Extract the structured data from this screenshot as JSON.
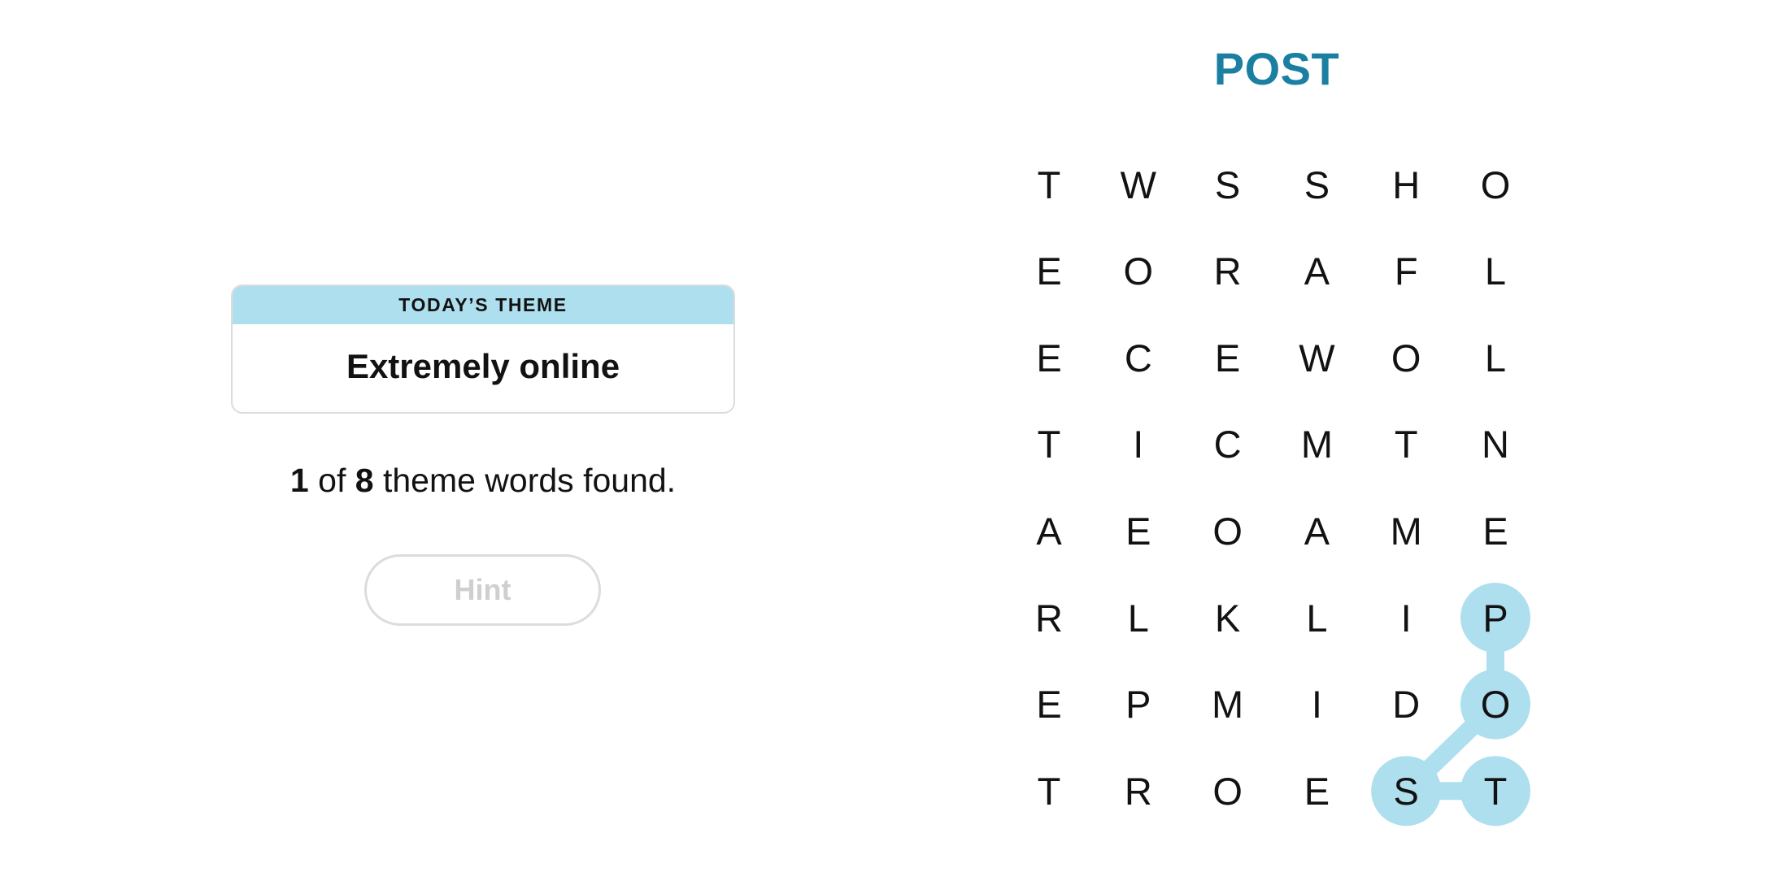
{
  "theme": {
    "header_label": "TODAY’S THEME",
    "title": "Extremely online"
  },
  "progress": {
    "found": "1",
    "of_label": "of",
    "total": "8",
    "suffix": "theme words found."
  },
  "hint_button": {
    "label": "Hint",
    "enabled": false
  },
  "current_word": "POST",
  "colors": {
    "accent_text": "#1a7fa0",
    "highlight": "#aedfee",
    "letter": "#121212"
  },
  "grid": {
    "rows": [
      [
        "T",
        "W",
        "S",
        "S",
        "H",
        "O"
      ],
      [
        "E",
        "O",
        "R",
        "A",
        "F",
        "L"
      ],
      [
        "E",
        "C",
        "E",
        "W",
        "O",
        "L"
      ],
      [
        "T",
        "I",
        "C",
        "M",
        "T",
        "N"
      ],
      [
        "A",
        "E",
        "O",
        "A",
        "M",
        "E"
      ],
      [
        "R",
        "L",
        "K",
        "L",
        "I",
        "P"
      ],
      [
        "E",
        "P",
        "M",
        "I",
        "D",
        "O"
      ],
      [
        "T",
        "R",
        "O",
        "E",
        "S",
        "T"
      ]
    ],
    "selected_path": [
      {
        "row": 5,
        "col": 5,
        "letter": "P"
      },
      {
        "row": 6,
        "col": 5,
        "letter": "O"
      },
      {
        "row": 7,
        "col": 4,
        "letter": "S"
      },
      {
        "row": 7,
        "col": 5,
        "letter": "T"
      }
    ]
  }
}
